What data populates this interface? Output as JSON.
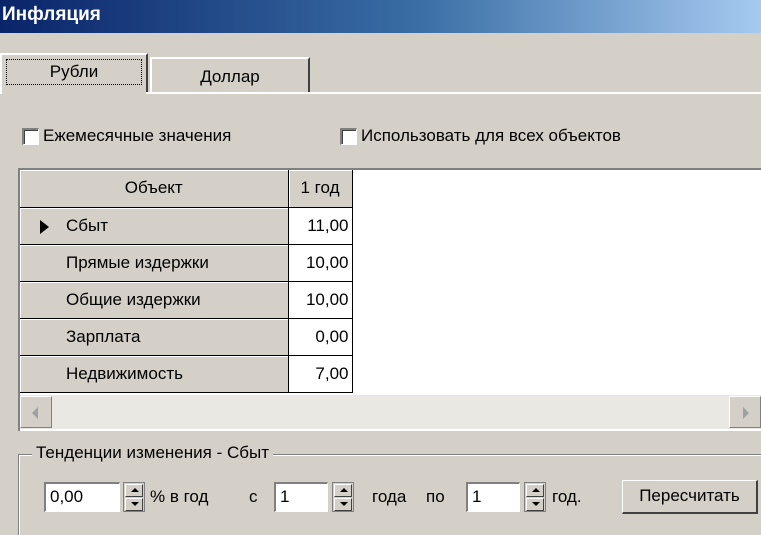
{
  "window": {
    "title": "Инфляция"
  },
  "tabs": [
    {
      "label": "Рубли",
      "active": true
    },
    {
      "label": "Доллар",
      "active": false
    }
  ],
  "options": {
    "monthly_label": "Ежемесячные значения",
    "monthly_checked": false,
    "all_objects_label": "Использовать для всех объектов",
    "all_objects_checked": false
  },
  "grid": {
    "columns": [
      "Объект",
      "1 год"
    ],
    "rows": [
      {
        "name": "Сбыт",
        "value": "11,00",
        "current": true
      },
      {
        "name": "Прямые издержки",
        "value": "10,00"
      },
      {
        "name": "Общие издержки",
        "value": "10,00"
      },
      {
        "name": "Зарплата",
        "value": "0,00"
      },
      {
        "name": "Недвижимость",
        "value": "7,00"
      }
    ]
  },
  "trend": {
    "title": "Тенденции изменения - Сбыт",
    "rate_value": "0,00",
    "rate_unit": "% в год",
    "from_label": "с",
    "from_value": "1",
    "years_label": "года",
    "to_label": "по",
    "to_value": "1",
    "year_label": "год.",
    "recalc_label": "Пересчитать"
  },
  "colors": {
    "title_bar": "#0a246a",
    "face": "#d4d0c8"
  }
}
